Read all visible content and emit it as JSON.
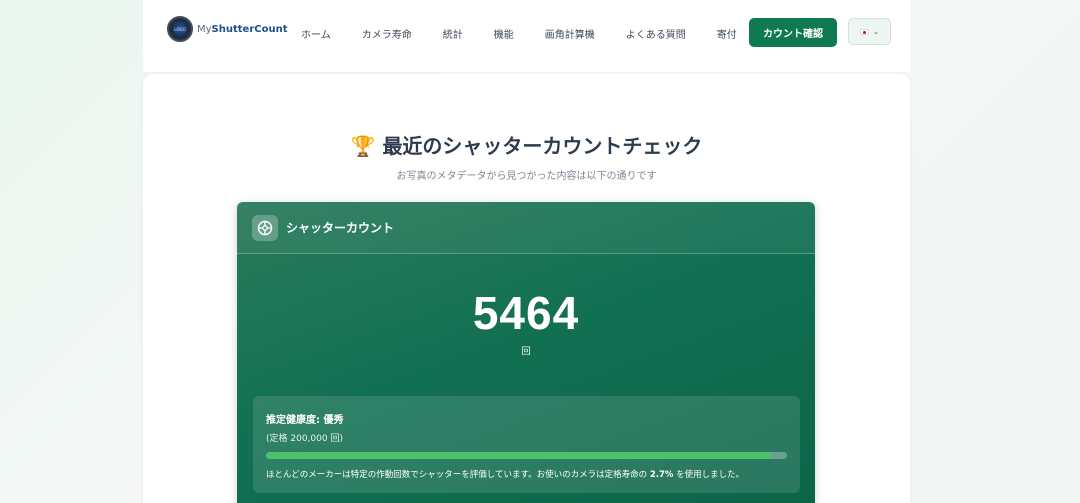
{
  "header": {
    "logo_prefix": "My",
    "logo_brand": "ShutterCount",
    "logo_circle_text": "LOGO",
    "nav": [
      "ホーム",
      "カメラ寿命",
      "統計",
      "機能",
      "画角計算機",
      "よくある質問",
      "寄付"
    ],
    "cta_label": "カウント確認",
    "lang_chevron": "⌄"
  },
  "main": {
    "title_icon": "🏆",
    "title": "最近のシャッターカウントチェック",
    "subtitle": "お写真のメタデータから見つかった内容は以下の通りです"
  },
  "card": {
    "head_icon": "shutter-icon",
    "head_label": "シャッターカウント",
    "count": "5464",
    "unit": "回",
    "health_title": "推定健康度: 優秀",
    "health_rated": "(定格 200,000 回)",
    "health_note_pre": "ほとんどのメーカーは特定の作動回数でシャッターを評価しています。お使いのカメラは定格寿命の",
    "health_note_pct": "2.7%",
    "health_note_post": "を使用しました。",
    "usage_percent": 97
  },
  "colors": {
    "accent": "#0f7a52",
    "bar": "#4cc26a"
  }
}
